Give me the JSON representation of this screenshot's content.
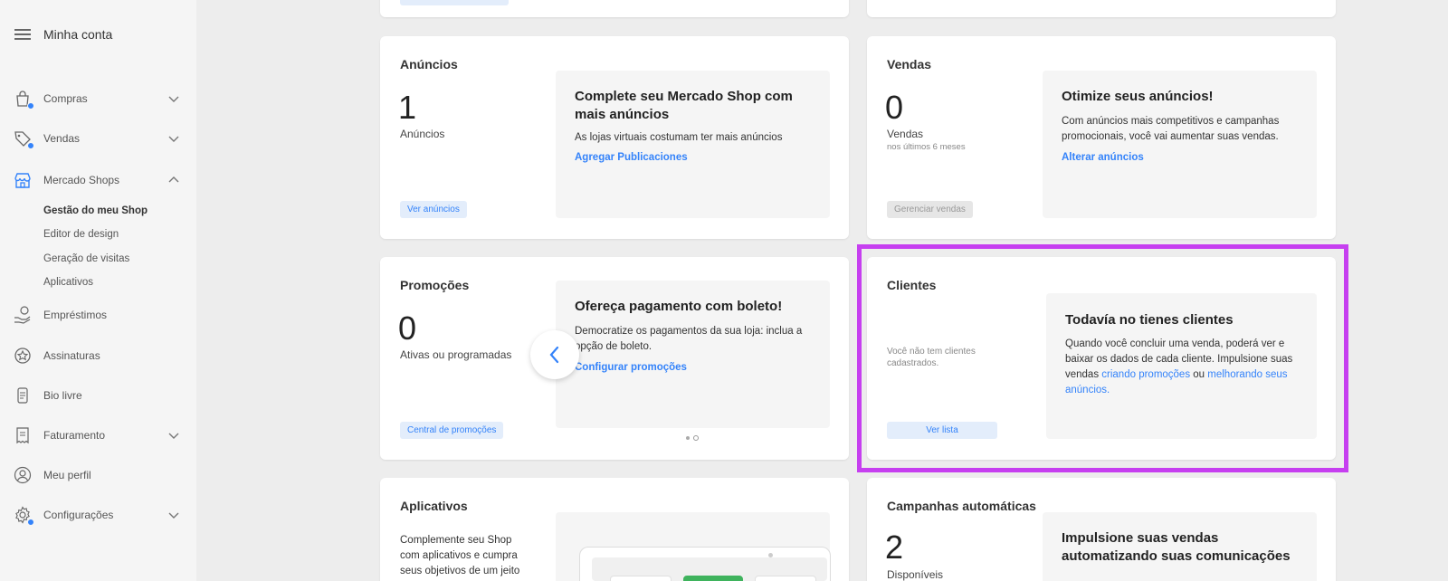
{
  "sidebar": {
    "title": "Minha conta",
    "items": [
      {
        "label": "Compras",
        "icon": "shopping-bag-icon",
        "has_dot": true,
        "chevron": "down"
      },
      {
        "label": "Vendas",
        "icon": "tag-icon",
        "has_dot": true,
        "chevron": "down"
      },
      {
        "label": "Mercado Shops",
        "icon": "store-icon",
        "has_dot": false,
        "chevron": "up"
      },
      {
        "label": "Empréstimos",
        "icon": "hand-money-icon",
        "has_dot": false
      },
      {
        "label": "Assinaturas",
        "icon": "star-badge-icon",
        "has_dot": false
      },
      {
        "label": "Bio livre",
        "icon": "bio-icon",
        "has_dot": false
      },
      {
        "label": "Faturamento",
        "icon": "receipt-icon",
        "has_dot": false,
        "chevron": "down"
      },
      {
        "label": "Meu perfil",
        "icon": "user-icon",
        "has_dot": false
      },
      {
        "label": "Configurações",
        "icon": "gear-icon",
        "has_dot": true,
        "chevron": "down"
      }
    ],
    "subitems": [
      "Gestão do meu Shop",
      "Editor de design",
      "Geração de visitas",
      "Aplicativos"
    ]
  },
  "anuncios": {
    "title": "Anúncios",
    "count": "1",
    "count_label": "Anúncios",
    "button": "Ver anúncios",
    "promo_title": "Complete seu Mercado Shop com mais anúncios",
    "promo_text": "As lojas virtuais costumam ter mais anúncios",
    "promo_link": "Agregar Publicaciones"
  },
  "vendas": {
    "title": "Vendas",
    "count": "0",
    "count_label": "Vendas",
    "count_sub": "nos últimos 6 meses",
    "button": "Gerenciar vendas",
    "promo_title": "Otimize seus anúncios!",
    "promo_text": "Com anúncios mais competitivos e campanhas promocionais, você vai aumentar suas vendas.",
    "promo_link": "Alterar anúncios"
  },
  "promocoes": {
    "title": "Promoções",
    "count": "0",
    "count_label": "Ativas ou programadas",
    "button": "Central de promoções",
    "promo_title": "Ofereça pagamento com boleto!",
    "promo_text": "Democratize os pagamentos da sua loja: inclua a opção de boleto.",
    "promo_link": "Configurar promoções"
  },
  "clientes": {
    "title": "Clientes",
    "empty": "Você não tem clientes cadastrados.",
    "button": "Ver lista",
    "promo_title": "Todavía no tienes clientes",
    "promo_text_1": "Quando você concluir uma venda, poderá ver e baixar os dados de cada cliente. Impulsione suas vendas ",
    "promo_link_1": "criando promoções",
    "promo_text_2": " ou ",
    "promo_link_2": "melhorando seus anúncios."
  },
  "aplicativos": {
    "title": "Aplicativos",
    "text": "Complemente seu Shop com aplicativos e cumpra seus objetivos de um jeito"
  },
  "campanhas": {
    "title": "Campanhas automáticas",
    "count": "2",
    "count_label": "Disponíveis",
    "promo_title": "Impulsione suas vendas automatizando suas comunicações"
  },
  "colors": {
    "accent": "#3483fa",
    "highlight": "#c63ff0"
  }
}
